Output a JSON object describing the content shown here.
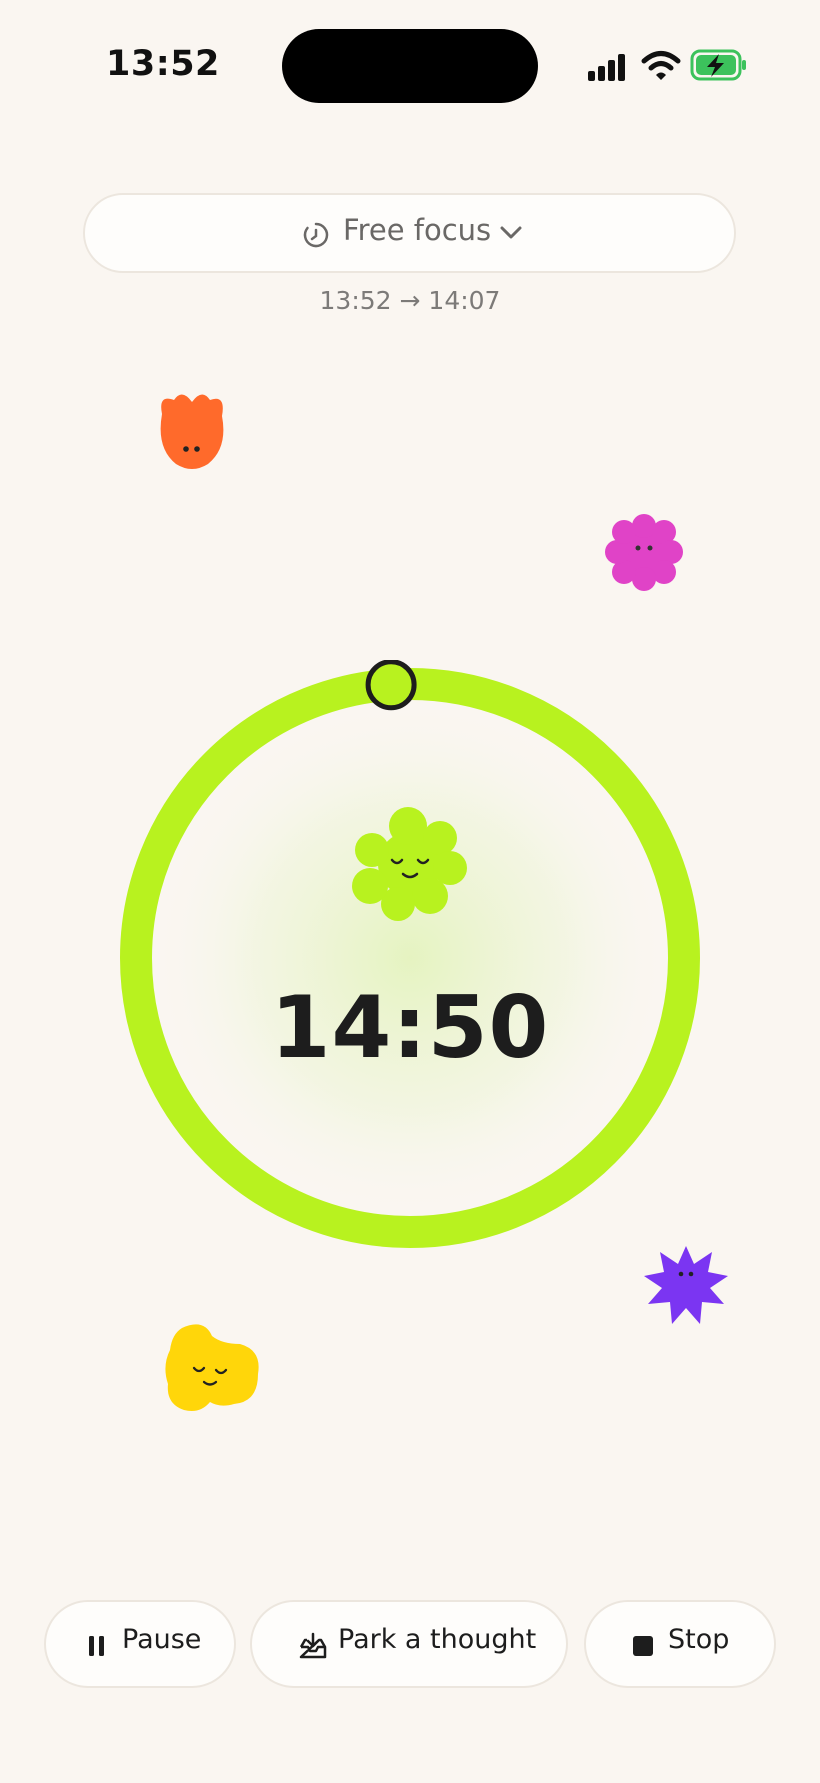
{
  "status_bar": {
    "time": "13:52",
    "icons": [
      "cellular-signal-icon",
      "wifi-icon",
      "battery-charging-icon"
    ]
  },
  "session": {
    "mode_label": "Free focus",
    "time_range": "13:52 → 14:07",
    "countdown": "14:50",
    "progress_fraction": 0.011
  },
  "creatures": [
    "orange-tulip-creature",
    "pink-flower-creature",
    "green-flower-creature",
    "purple-star-creature",
    "yellow-blob-creature"
  ],
  "actions": {
    "pause_label": "Pause",
    "park_label": "Park a thought",
    "stop_label": "Stop"
  },
  "colors": {
    "background": "#faf6f1",
    "accent": "#b8f21f",
    "orange": "#ff6a2b",
    "pink": "#e043c7",
    "purple": "#7b35f2",
    "yellow": "#ffd60a",
    "battery": "#3cc25c"
  }
}
